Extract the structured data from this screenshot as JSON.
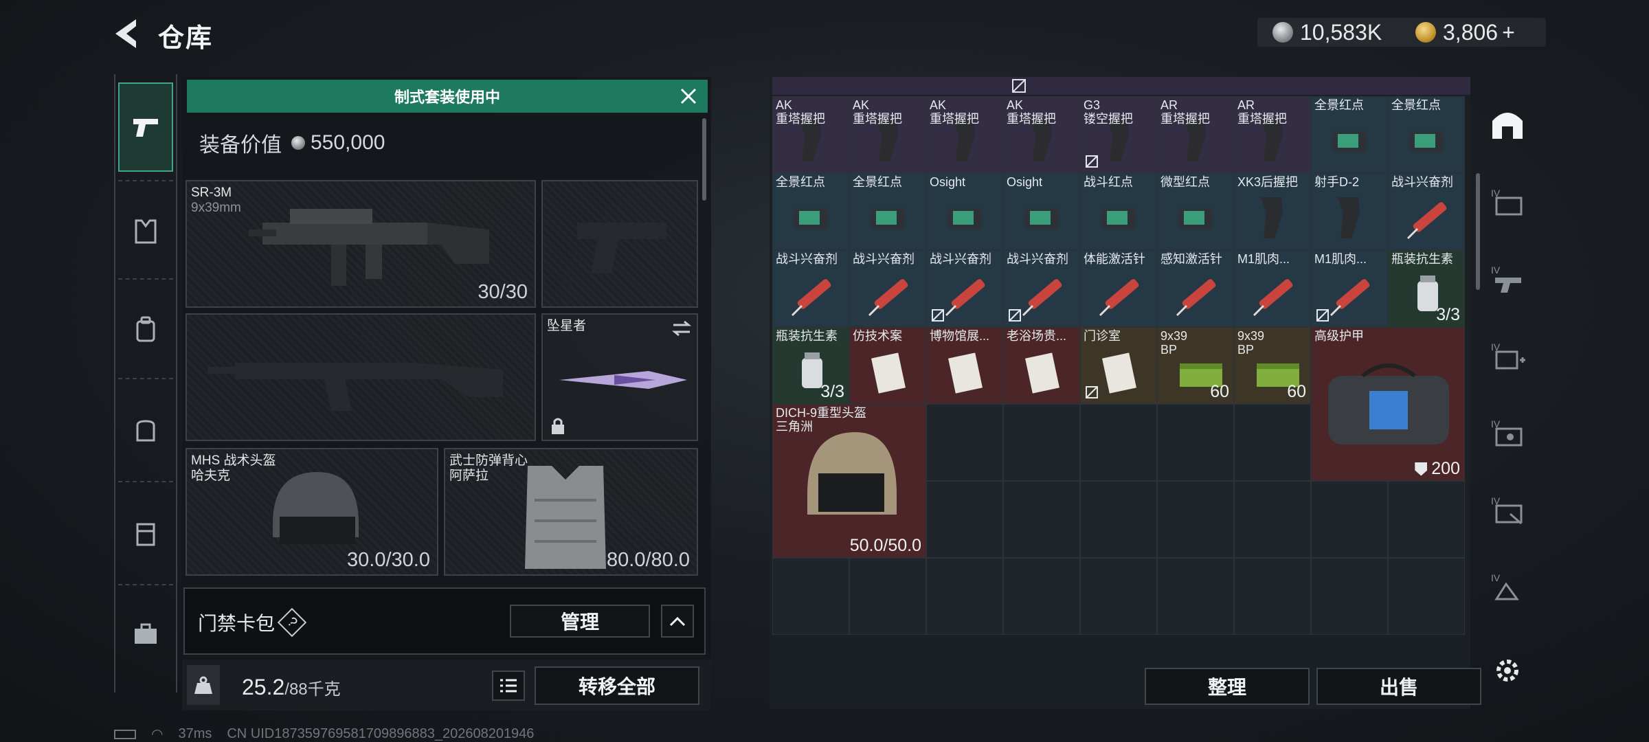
{
  "header": {
    "title": "仓库",
    "currency_silver": "10,583K",
    "currency_gold": "3,806",
    "currency_gold_plus": "+"
  },
  "loadout": {
    "banner": "制式套装使用中",
    "value_label": "装备价值",
    "value": "550,000",
    "primary": {
      "name": "SR-3M",
      "ammo": "9x39mm",
      "count": "30/30"
    },
    "melee": {
      "name": "坠星者"
    },
    "helmet": {
      "name": "MHS 战术头盔",
      "sub": "哈夫克",
      "durability": "30.0/30.0"
    },
    "armor": {
      "name": "武士防弹背心",
      "sub": "阿萨拉",
      "durability": "80.0/80.0"
    },
    "keycard_label": "门禁卡包",
    "help": "?",
    "manage": "管理",
    "weight": "25.2",
    "weight_max": "/88千克",
    "transfer_all": "转移全部"
  },
  "inventory": {
    "rows": [
      [
        {
          "name": "AK\n重塔握把",
          "bg": "purple",
          "icon": "grip-icon"
        },
        {
          "name": "AK\n重塔握把",
          "bg": "purple",
          "icon": "grip-icon"
        },
        {
          "name": "AK\n重塔握把",
          "bg": "purple",
          "icon": "grip-icon"
        },
        {
          "name": "AK\n重塔握把",
          "bg": "purple",
          "icon": "grip-icon"
        },
        {
          "name": "G3\n镂空握把",
          "bg": "purple",
          "icon": "grip-icon",
          "locked": true
        },
        {
          "name": "AR\n重塔握把",
          "bg": "purple",
          "icon": "grip-icon"
        },
        {
          "name": "AR\n重塔握把",
          "bg": "purple",
          "icon": "grip-icon"
        },
        {
          "name": "全景红点",
          "bg": "blue",
          "icon": "sight-icon"
        },
        {
          "name": "全景红点",
          "bg": "blue",
          "icon": "sight-icon"
        }
      ],
      [
        {
          "name": "全景红点",
          "bg": "blue",
          "icon": "sight-icon"
        },
        {
          "name": "全景红点",
          "bg": "blue",
          "icon": "sight-icon"
        },
        {
          "name": "Osight",
          "bg": "blue",
          "icon": "sight-icon"
        },
        {
          "name": "Osight",
          "bg": "blue",
          "icon": "sight-icon"
        },
        {
          "name": "战斗红点",
          "bg": "blue",
          "icon": "sight-icon"
        },
        {
          "name": "微型红点",
          "bg": "blue",
          "icon": "sight-icon"
        },
        {
          "name": "XK3后握把",
          "bg": "blue",
          "icon": "grip-icon"
        },
        {
          "name": "射手D-2",
          "bg": "blue",
          "icon": "grip-icon"
        },
        {
          "name": "战斗兴奋剂",
          "bg": "blue",
          "icon": "syringe-icon"
        }
      ],
      [
        {
          "name": "战斗兴奋剂",
          "bg": "blue",
          "icon": "syringe-icon"
        },
        {
          "name": "战斗兴奋剂",
          "bg": "blue",
          "icon": "syringe-icon"
        },
        {
          "name": "战斗兴奋剂",
          "bg": "blue",
          "icon": "syringe-icon",
          "locked": true
        },
        {
          "name": "战斗兴奋剂",
          "bg": "blue",
          "icon": "syringe-icon",
          "locked": true
        },
        {
          "name": "体能激活针",
          "bg": "blue",
          "icon": "syringe-icon"
        },
        {
          "name": "感知激活针",
          "bg": "blue",
          "icon": "syringe-icon"
        },
        {
          "name": "M1肌肉...",
          "bg": "blue",
          "icon": "syringe-icon"
        },
        {
          "name": "M1肌肉...",
          "bg": "blue",
          "icon": "syringe-icon",
          "locked": true
        },
        {
          "name": "瓶装抗生素",
          "bg": "green",
          "icon": "bottle-icon",
          "count": "3/3"
        }
      ],
      [
        {
          "name": "瓶装抗生素",
          "bg": "green",
          "icon": "bottle-icon",
          "count": "3/3"
        },
        {
          "name": "仿技术案",
          "bg": "red",
          "icon": "document-icon"
        },
        {
          "name": "博物馆展...",
          "bg": "red",
          "icon": "document-icon"
        },
        {
          "name": "老浴场贵...",
          "bg": "red",
          "icon": "document-icon"
        },
        {
          "name": "门诊室",
          "bg": "gold",
          "icon": "document-icon",
          "locked": true
        },
        {
          "name": "9x39\nBP",
          "bg": "gold",
          "icon": "ammo-box-icon",
          "count": "60"
        },
        {
          "name": "9x39\nBP",
          "bg": "gold",
          "icon": "ammo-box-icon",
          "count": "60"
        }
      ]
    ],
    "big_items": {
      "armor_bag": {
        "name": "高级护甲",
        "count": "200"
      },
      "helmet": {
        "name": "DICH-9重型头盔\n三角洲",
        "durability": "50.0/50.0"
      }
    },
    "sort_button": "整理",
    "sell_button": "出售"
  },
  "status": {
    "ping": "37ms",
    "uid": "CN UID18735976958170989688​3_202608201946"
  }
}
